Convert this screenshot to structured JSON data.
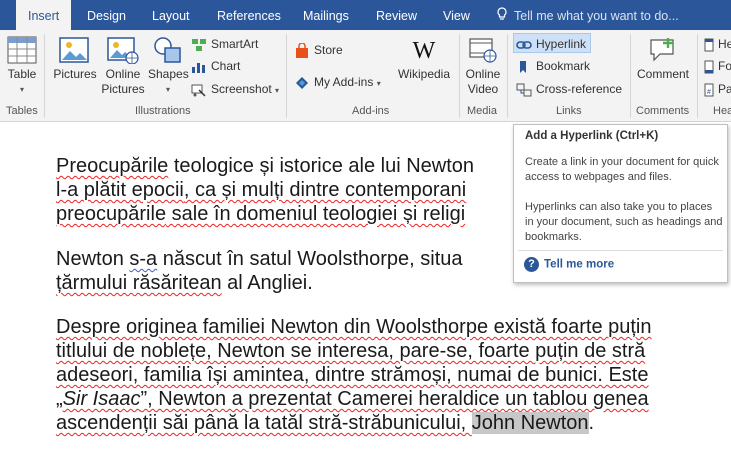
{
  "tabs": [
    {
      "label": "Insert",
      "active": true
    },
    {
      "label": "Design"
    },
    {
      "label": "Layout"
    },
    {
      "label": "References"
    },
    {
      "label": "Mailings"
    },
    {
      "label": "Review"
    },
    {
      "label": "View"
    }
  ],
  "tell_me": "Tell me what you want to do...",
  "ribbon": {
    "groups": {
      "tables": "Tables",
      "illustrations": "Illustrations",
      "addins": "Add-ins",
      "media": "Media",
      "links": "Links",
      "comments": "Comments",
      "header": "Hea"
    },
    "buttons": {
      "table": "Table",
      "pictures": "Pictures",
      "online_pictures_1": "Online",
      "online_pictures_2": "Pictures",
      "shapes": "Shapes",
      "smartart": "SmartArt",
      "chart": "Chart",
      "screenshot": "Screenshot",
      "store": "Store",
      "my_addins": "My Add-ins",
      "wikipedia": "Wikipedia",
      "online_video_1": "Online",
      "online_video_2": "Video",
      "hyperlink": "Hyperlink",
      "bookmark": "Bookmark",
      "cross_reference": "Cross-reference",
      "comment": "Comment",
      "header_1": "He",
      "header_2": "Fo",
      "header_3": "Pa"
    }
  },
  "colors": {
    "accent": "#2b579a",
    "ribbon_bg": "#f3f3f3",
    "hover": "#cde0f5",
    "spell_error": "#e22"
  },
  "tooltip": {
    "title": "Add a Hyperlink (Ctrl+K)",
    "text1": "Create a link in your document for quick access to webpages and files.",
    "text2": "Hyperlinks can also take you to places in your document, such as headings and bookmarks.",
    "more": "Tell me more"
  },
  "document": {
    "p1": [
      {
        "a": "Preocupările",
        "b": " teologice și istorice ale lui Newton"
      },
      {
        "a": "l-a plătit epocii",
        "b": ", ca și mulți dintre contemporani"
      },
      {
        "a": "preocupările",
        "b": " sale în domeniul teologiei și religi"
      }
    ],
    "p2": [
      {
        "a": "Newton ",
        "b": "s-a",
        "c": " născut în satul Woolsthorpe, situa"
      },
      {
        "a": "țărmului răsăritean",
        "b": " al Angliei."
      }
    ],
    "p3": [
      {
        "a": "Despre originea familiei Newton din Woolsthorpe există foarte puțin"
      },
      {
        "a": "titlului de noblețe, Newton se interesa, pare-se, foarte puțin de stră"
      },
      {
        "a": "adeseori, familia își amintea, dintre strămoși, numai de bunici. Este"
      },
      {
        "a": "„",
        "b": "Sir Isaac",
        "c": "”, Newton a prezentat Camerei heraldice un tablou genea"
      },
      {
        "a": "ascendenții săi până la tatăl stră-străbunicului, ",
        "b": "John Newton",
        "c": "."
      }
    ]
  }
}
